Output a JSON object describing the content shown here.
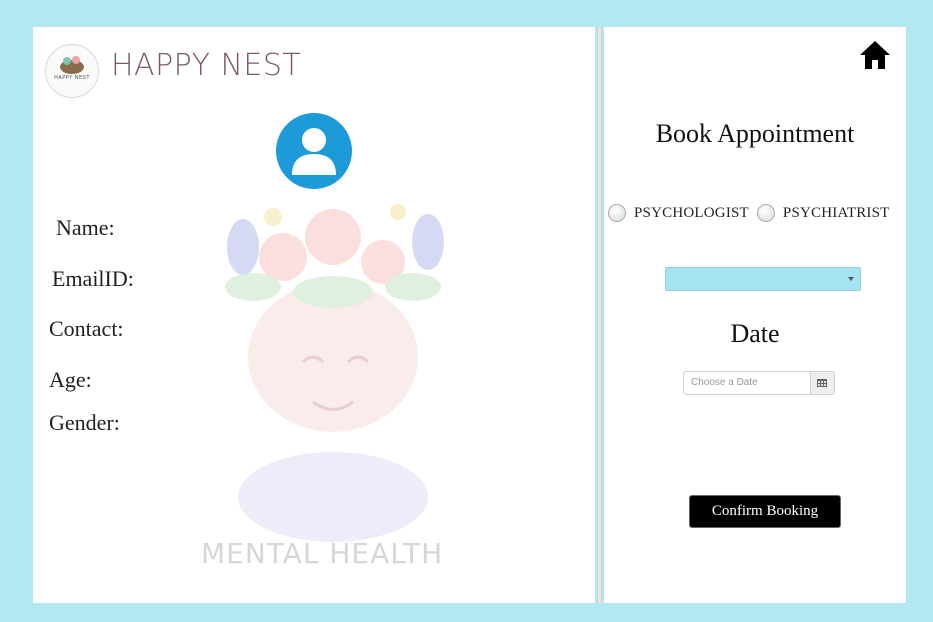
{
  "brand": {
    "name": "HAPPY NEST",
    "logo_text": "HAPPY NEST"
  },
  "profile": {
    "labels": {
      "name": "Name:",
      "email": "EmailID:",
      "contact": "Contact:",
      "age": "Age:",
      "gender": "Gender:"
    },
    "avatar_icon": "user-icon",
    "illustration_caption": "MENTAL HEALTH"
  },
  "booking": {
    "title": "Book Appointment",
    "options": [
      "PSYCHOLOGIST",
      "PSYCHIATRIST"
    ],
    "dropdown_value": "",
    "date_title": "Date",
    "date_placeholder": "Choose a Date",
    "confirm_label": "Confirm Booking"
  },
  "icons": {
    "home": "home-icon",
    "calendar": "calendar-icon",
    "dropdown": "chevron-down-icon"
  },
  "colors": {
    "background": "#b2e8f2",
    "brand": "#7b5a66",
    "avatar": "#1d9bd8",
    "dropdown": "#a6e3f0",
    "button": "#000000"
  }
}
